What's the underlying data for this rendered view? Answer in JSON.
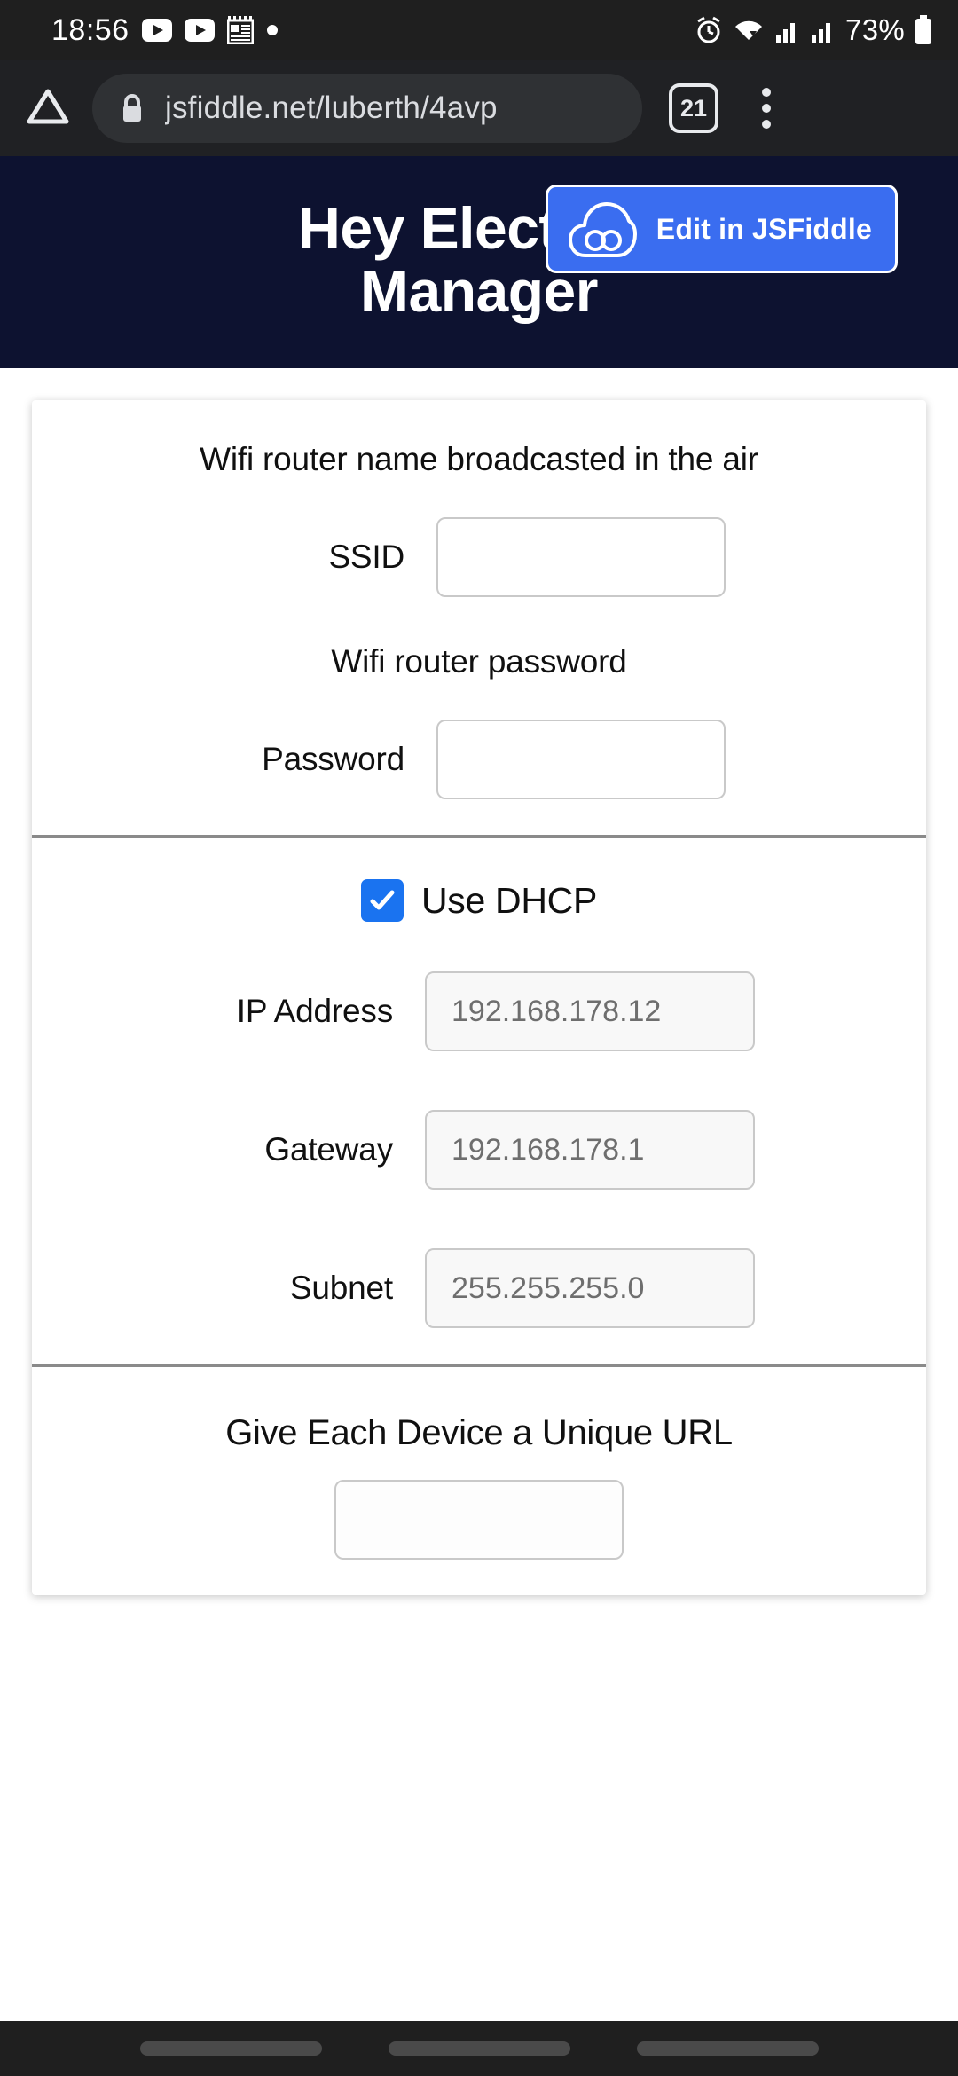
{
  "status_bar": {
    "clock": "18:56",
    "battery_percent": "73%",
    "left_icons": [
      "youtube-icon",
      "youtube-icon",
      "news-icon",
      "dot-icon"
    ],
    "right_icons": [
      "alarm-icon",
      "wifi-icon",
      "signal-icon",
      "signal-icon",
      "battery-icon"
    ]
  },
  "browser": {
    "home_icon": "home-icon",
    "lock_icon": "lock-icon",
    "url": "jsfiddle.net/luberth/4avp",
    "tab_count": "21",
    "menu_icon": "overflow-menu-icon"
  },
  "page_header": {
    "title_line1": "Hey Electra, I",
    "title_line2": "Manager",
    "background_color": "#0d1230",
    "jsfiddle_button": {
      "label": "Edit in JSFiddle",
      "icon": "jsfiddle-cloud-icon",
      "color": "#3a6df0"
    }
  },
  "form": {
    "wifi_section": {
      "ssid_hint": "Wifi router name broadcasted in the air",
      "ssid_label": "SSID",
      "ssid_value": "",
      "ssid_placeholder": "",
      "password_hint": "Wifi router password",
      "password_label": "Password",
      "password_value": "",
      "password_placeholder": ""
    },
    "network_section": {
      "dhcp_label": "Use DHCP",
      "dhcp_checked": true,
      "checkbox_color": "#1a73f0",
      "fields": [
        {
          "label": "IP Address",
          "value": "192.168.178.12"
        },
        {
          "label": "Gateway",
          "value": "192.168.178.1"
        },
        {
          "label": "Subnet",
          "value": "255.255.255.0"
        }
      ]
    },
    "url_section": {
      "title": "Give Each Device a Unique URL"
    }
  }
}
